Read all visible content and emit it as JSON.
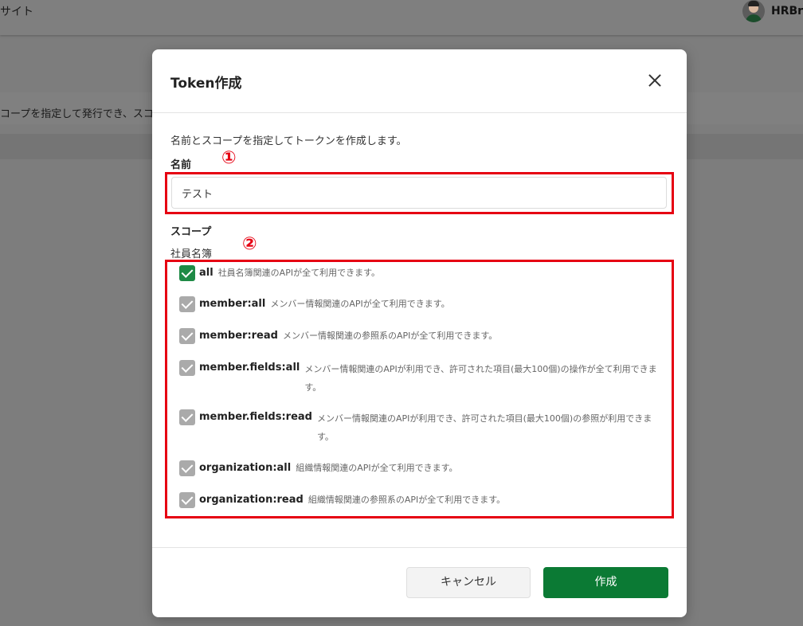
{
  "background": {
    "site_label": "サイト",
    "user_name": "HRBra",
    "page_description": "コープを指定して発行でき、スコ"
  },
  "modal": {
    "title": "Token作成",
    "intro": "名前とスコープを指定してトークンを作成します。",
    "name_label": "名前",
    "name_value": "テスト",
    "scope_label": "スコープ",
    "scope_group": "社員名簿",
    "scopes": [
      {
        "name": "all",
        "desc": "社員名簿関連のAPIが全て利用できます。",
        "checked": true
      },
      {
        "name": "member:all",
        "desc": "メンバー情報関連のAPIが全て利用できます。",
        "checked": true
      },
      {
        "name": "member:read",
        "desc": "メンバー情報関連の参照系のAPIが全て利用できます。",
        "checked": true
      },
      {
        "name": "member.fields:all",
        "desc": "メンバー情報関連のAPIが利用でき、許可された項目(最大100個)の操作が全て利用できます。",
        "checked": true
      },
      {
        "name": "member.fields:read",
        "desc": "メンバー情報関連のAPIが利用でき、許可された項目(最大100個)の参照が利用できます。",
        "checked": true
      },
      {
        "name": "organization:all",
        "desc": "組織情報関連のAPIが全て利用できます。",
        "checked": true
      },
      {
        "name": "organization:read",
        "desc": "組織情報関連の参照系のAPIが全て利用できます。",
        "checked": true
      }
    ],
    "cancel_label": "キャンセル",
    "create_label": "作成"
  },
  "annotations": {
    "marker_1": "①",
    "marker_2": "②",
    "color": "#e60012"
  },
  "colors": {
    "primary": "#0b7a34",
    "checkbox_active": "#1e8a45",
    "checkbox_inherited": "#aaaaaa"
  }
}
